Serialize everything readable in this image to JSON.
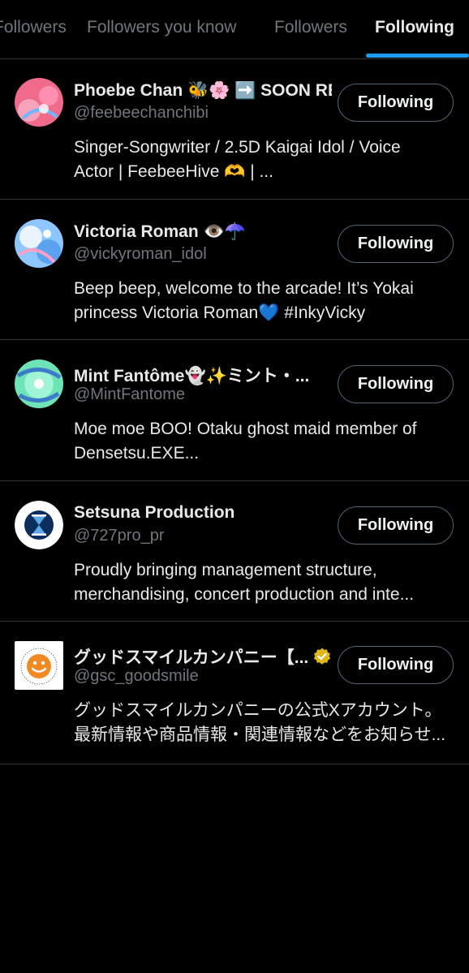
{
  "tabs": [
    {
      "label": "Followers"
    },
    {
      "label": "Followers you know"
    },
    {
      "label": "Followers"
    },
    {
      "label": "Following"
    }
  ],
  "active_tab": "Following",
  "accent_color": "#1d9bf0",
  "users": [
    {
      "name": "Phoebe Chan 🐝🌸 ➡️ SOON REBL...",
      "handle": "@feebeechanchibi",
      "bio": [
        "Singer-Songwriter / 2.5D Kaigai Idol / Voice",
        "Actor | FeebeeHive 🫶 | ..."
      ],
      "button": "Following",
      "avatar_icon": "pink-anime-avatar"
    },
    {
      "name": "Victoria Roman 👁️☂️",
      "handle": "@vickyroman_idol",
      "bio": [
        "Beep beep, welcome to the arcade! It’s Yokai",
        "princess Victoria Roman💙 #InkyVicky"
      ],
      "button": "Following",
      "avatar_icon": "blue-anime-avatar"
    },
    {
      "name": "Mint Fantôme👻✨ミント・...",
      "handle": "@MintFantome",
      "bio": [
        "Moe moe BOO! Otaku ghost maid member of",
        "Densetsu.EXE..."
      ],
      "button": "Following",
      "avatar_icon": "mint-anime-avatar"
    },
    {
      "name": "Setsuna Production",
      "handle": "@727pro_pr",
      "bio": [
        "Proudly bringing management structure,",
        "merchandising, concert production and inte..."
      ],
      "button": "Following",
      "avatar_icon": "hourglass-logo-avatar"
    },
    {
      "name": "グッドスマイルカンパニー【...",
      "handle": "@gsc_goodsmile",
      "bio": [
        "グッドスマイルカンパニーの公式Xアカウント。",
        "最新情報や商品情報・関連情報などをお知らせ..."
      ],
      "button": "Following",
      "avatar_icon": "smiley-logo-avatar",
      "logo_text": "GOOD SMILE COMPANY JAPAN OFFICIAL",
      "verified": true,
      "verified_icon": "gold-verified-badge-icon"
    }
  ]
}
